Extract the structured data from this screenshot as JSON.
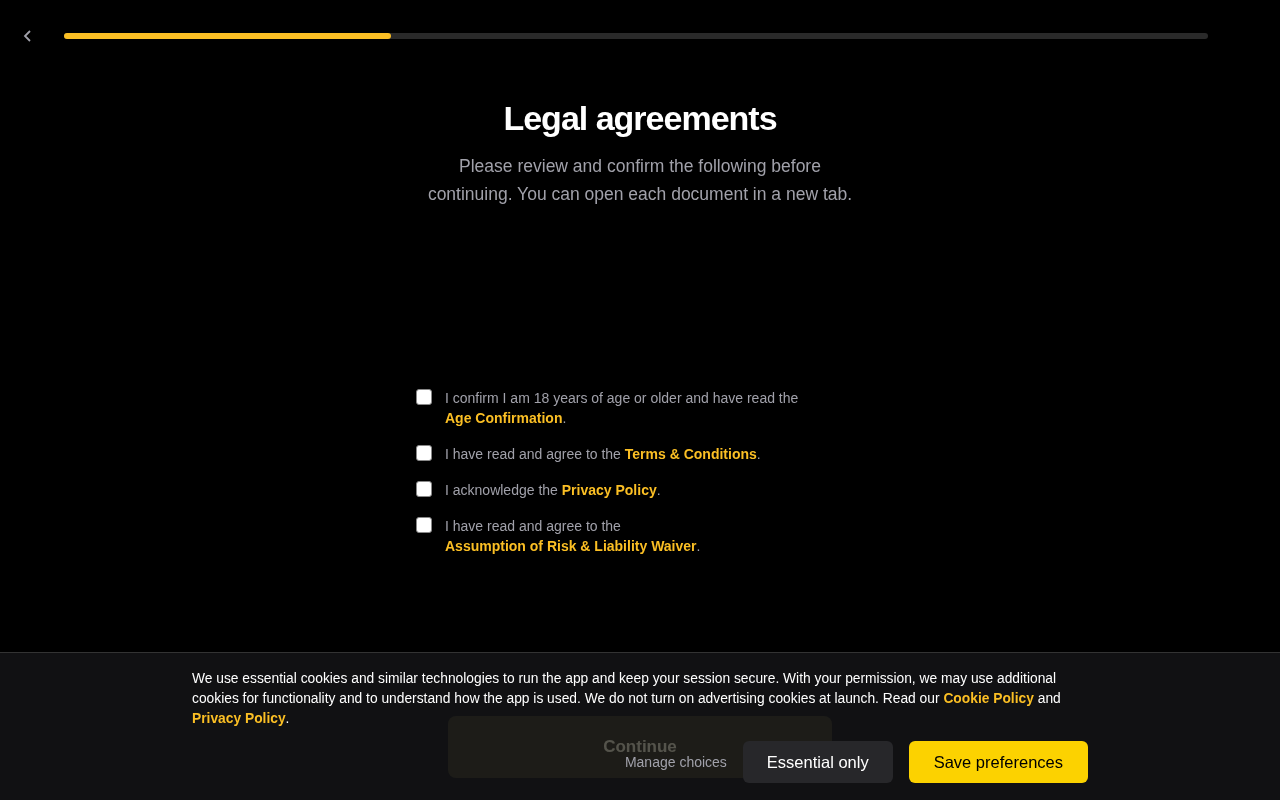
{
  "progress": {
    "level": 0.286
  },
  "title": "Legal agreements",
  "subtitle": "Please review and confirm the following before continuing. You can open each document in a new tab.",
  "agreements": [
    {
      "checked": false,
      "text": "I confirm I am 18 years of age or older and have read the",
      "link": "Age Confirmation",
      "after": "."
    },
    {
      "checked": false,
      "text": "I have read and agree to the",
      "link": "Terms & Conditions",
      "after": "."
    },
    {
      "checked": false,
      "text": "I acknowledge the",
      "link": "Privacy Policy",
      "after": "."
    },
    {
      "checked": false,
      "text": "I have read and agree to the",
      "link": "Assumption of Risk & Liability Waiver",
      "after": "."
    }
  ],
  "continue_button": {
    "label": "Continue",
    "disabled": true
  },
  "cookie_banner": {
    "segments": [
      {
        "kind": "text",
        "text": "We use essential cookies and similar technologies to run the app and keep your session secure. With your permission, we may use additional cookies for functionality and to understand how the app is used. We do not turn on advertising cookies at launch. Read our"
      },
      {
        "kind": "link",
        "text": "Cookie Policy"
      },
      {
        "kind": "text",
        "text": "and"
      },
      {
        "kind": "link",
        "text": "Privacy Policy"
      },
      {
        "kind": "text",
        "text": "."
      }
    ],
    "buttons": [
      {
        "kind": "plain",
        "label": "Manage choices"
      },
      {
        "kind": "secondary",
        "label": "Essential only"
      },
      {
        "kind": "primary",
        "label": "Save preferences"
      }
    ]
  }
}
